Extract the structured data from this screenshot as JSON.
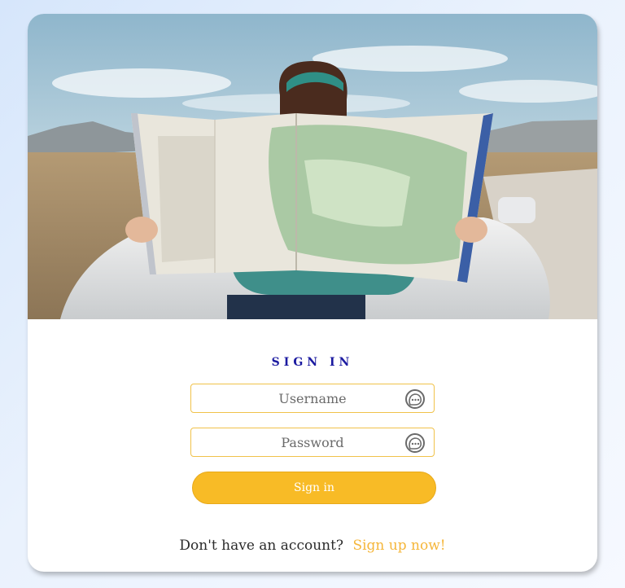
{
  "hero": {
    "image_description": ""
  },
  "form": {
    "title": "SIGN IN",
    "username_placeholder": "Username",
    "password_placeholder": "Password",
    "field_icon": "chat-bubble-dots-icon",
    "submit_label": "Sign in"
  },
  "footer": {
    "prompt": "Don't have an account?",
    "signup_link": "Sign up now!"
  },
  "colors": {
    "accent": "#f8bb26",
    "title": "#1b1aa0",
    "field_border": "#f0c24a",
    "link": "#f5b63a"
  }
}
